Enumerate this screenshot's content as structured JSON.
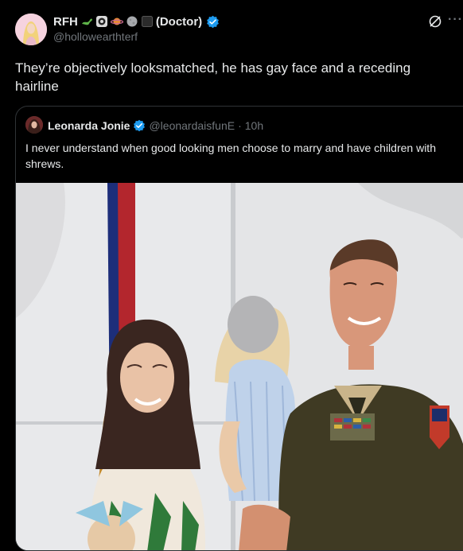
{
  "post": {
    "author": {
      "display_name": "RFH",
      "suffix": "(Doctor)",
      "emoji_icons": [
        "lizard-icon",
        "target-icon",
        "planet-icon",
        "moon-icon",
        "black-square-icon"
      ],
      "handle": "@hollowearthterf",
      "verified": true
    },
    "text": "They’re objectively looksmatched, he has gay face and a receding hairline",
    "quoted": {
      "author": {
        "display_name": "Leonarda Jonie",
        "handle": "@leonardaisfunE",
        "time": "10h",
        "verified": true
      },
      "text": "I never understand when good looking men choose to marry and have children with shrews.",
      "media": {
        "description_icon": "photo"
      }
    }
  },
  "colors": {
    "background": "#000000",
    "text": "#e7e9ea",
    "muted": "#71767b",
    "verified": "#1d9bf0",
    "border": "#2f3336"
  }
}
